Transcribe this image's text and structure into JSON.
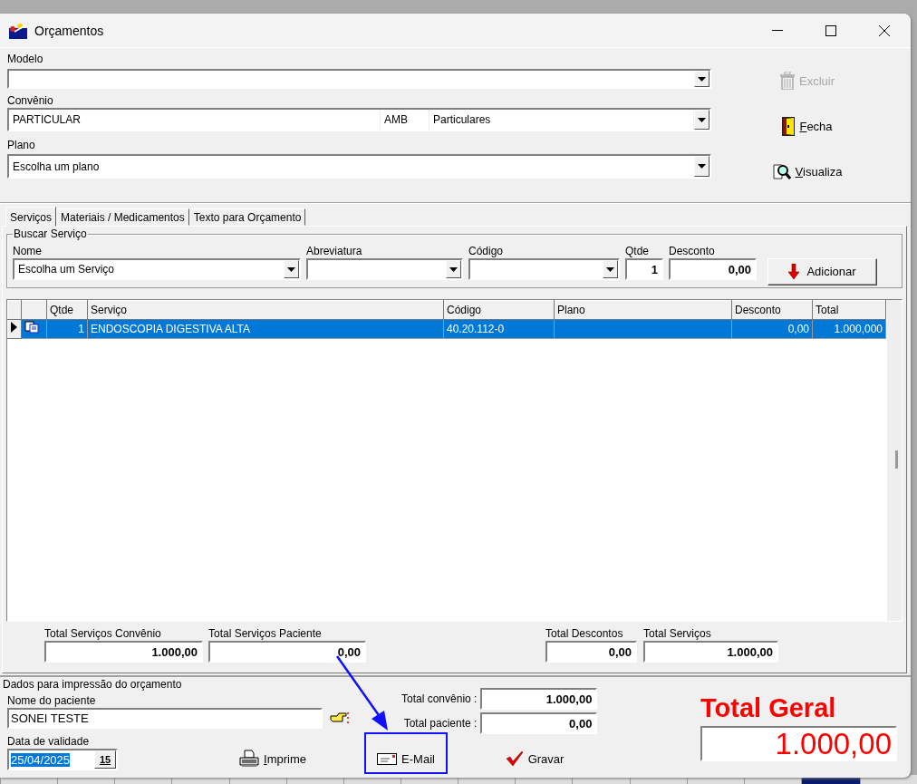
{
  "window": {
    "title": "Orçamentos"
  },
  "modelo": {
    "label": "Modelo"
  },
  "convenio": {
    "label": "Convênio",
    "value": "PARTICULAR",
    "tabela": "AMB",
    "tabela_nome": "Particulares"
  },
  "plano": {
    "label": "Plano",
    "value": "Escolha um plano"
  },
  "side_buttons": [
    {
      "label": "Excluir",
      "kind": "trash",
      "disabled": true,
      "accelerator": false
    },
    {
      "label": "Fecha",
      "kind": "door",
      "disabled": false,
      "accelerator": true
    },
    {
      "label": "Visualiza",
      "kind": "preview",
      "disabled": false,
      "accelerator": true
    }
  ],
  "tabs": [
    {
      "label": "Serviços",
      "selected": true
    },
    {
      "label": "Materiais / Medicamentos",
      "selected": false
    },
    {
      "label": "Texto para Orçamento",
      "selected": false
    }
  ],
  "search": {
    "title": "Buscar Serviço",
    "fields": [
      {
        "label": "Nome",
        "kind": "combo",
        "value": "Escolha um Serviço"
      },
      {
        "label": "Abreviatura",
        "kind": "combo"
      },
      {
        "label": "Código",
        "kind": "combo"
      },
      {
        "label": "Qtde",
        "kind": "number",
        "value": "1"
      },
      {
        "label": "Desconto",
        "kind": "number",
        "value": "0,00"
      }
    ],
    "add_button": "Adicionar"
  },
  "table": {
    "columns": [
      "Qtde",
      "Serviço",
      "Código",
      "Plano",
      "Desconto",
      "Total"
    ],
    "rows": [
      {
        "selected": true,
        "current": true,
        "qtde": "1",
        "servico": "ENDOSCOPIA DIGESTIVA ALTA",
        "codigo": "40.20.112-0",
        "desconto": "0,00",
        "total": "1.000,000"
      }
    ]
  },
  "totals": [
    {
      "label": "Total Serviços Convênio",
      "value": "1.000,00"
    },
    {
      "label": "Total Serviços Paciente",
      "value": "0,00"
    },
    {
      "label": "Total Descontos",
      "value": "0,00"
    },
    {
      "label": "Total Serviços",
      "value": "1.000,00"
    }
  ],
  "print_data": {
    "title": "Dados para impressão do orçamento",
    "patient_label": "Nome do paciente",
    "patient": "SONEI TESTE",
    "validity_label": "Data de validade",
    "validity": "25/04/2025",
    "validity_selected": true,
    "calendar_button": "15"
  },
  "summary": [
    {
      "label": "Total convênio :",
      "value": "1.000,00"
    },
    {
      "label": "Total paciente :",
      "value": "0,00"
    }
  ],
  "actions": [
    {
      "label": "Imprime",
      "kind": "print",
      "accelerator": true,
      "highlighted": false
    },
    {
      "label": "E-Mail",
      "kind": "mail",
      "accelerator": false,
      "highlighted": true
    },
    {
      "label": "Gravar",
      "kind": "save",
      "accelerator": false,
      "highlighted": false
    }
  ],
  "grand_total": {
    "label": "Total Geral",
    "value": "1.000,00"
  }
}
